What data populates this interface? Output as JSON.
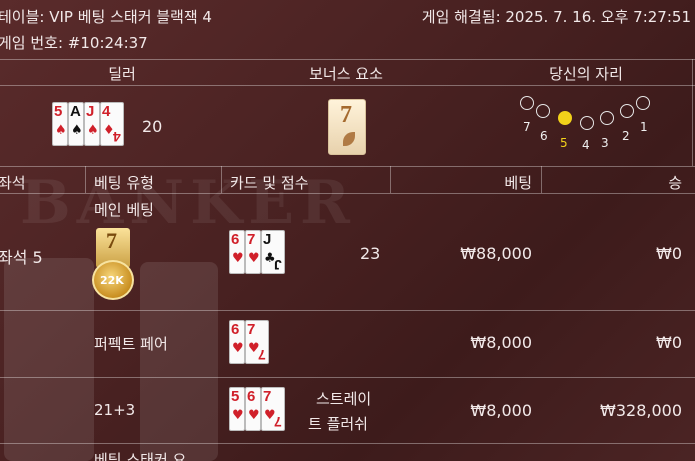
{
  "header": {
    "table_label": "테이블: VIP 베팅 스태커 블랙잭 4",
    "game_number": "게임 번호: #10:24:37",
    "resolved": "게임 해결됨: 2025. 7. 16. 오후 7:27:51"
  },
  "watermark": "BANKER",
  "summary": {
    "dealer_label": "딜러",
    "bonus_label": "보너스 요소",
    "seat_label": "당신의 자리",
    "dealer_score": "20",
    "dealer_cards": [
      {
        "rank": "5",
        "suit": "♠",
        "color": "red"
      },
      {
        "rank": "A",
        "suit": "♠",
        "color": "blk"
      },
      {
        "rank": "J",
        "suit": "♠",
        "color": "red"
      },
      {
        "rank": "4",
        "suit": "♦",
        "color": "red"
      }
    ],
    "bonus_card": "7",
    "seats": [
      "7",
      "6",
      "5",
      "4",
      "3",
      "2",
      "1"
    ],
    "selected_seat": "5"
  },
  "table": {
    "columns": [
      "좌석",
      "베팅 유형",
      "카드 및 점수",
      "베팅",
      "승"
    ],
    "main_bet_label": "메인 베팅",
    "seat_label": "좌석 5",
    "chip_value": "22K",
    "chip_card": "7",
    "rows": [
      {
        "type": "",
        "cards": [
          {
            "rank": "6",
            "suit": "♥",
            "color": "red"
          },
          {
            "rank": "7",
            "suit": "♥",
            "color": "red"
          },
          {
            "rank": "J",
            "suit": "♣",
            "color": "blk"
          }
        ],
        "score": "23",
        "bet": "₩88,000",
        "win": "₩0"
      },
      {
        "type": "퍼펙트 페어",
        "cards": [
          {
            "rank": "6",
            "suit": "♥",
            "color": "red"
          },
          {
            "rank": "7",
            "suit": "♥",
            "color": "red"
          }
        ],
        "score": "",
        "bet": "₩8,000",
        "win": "₩0"
      },
      {
        "type": "21+3",
        "cards": [
          {
            "rank": "5",
            "suit": "♥",
            "color": "red"
          },
          {
            "rank": "6",
            "suit": "♥",
            "color": "red"
          },
          {
            "rank": "7",
            "suit": "♥",
            "color": "red"
          }
        ],
        "score_line1": "스트레이",
        "score_line2": "트 플러쉬",
        "bet": "₩8,000",
        "win": "₩328,000"
      }
    ],
    "partial_row": "베팅 스태커 요"
  }
}
